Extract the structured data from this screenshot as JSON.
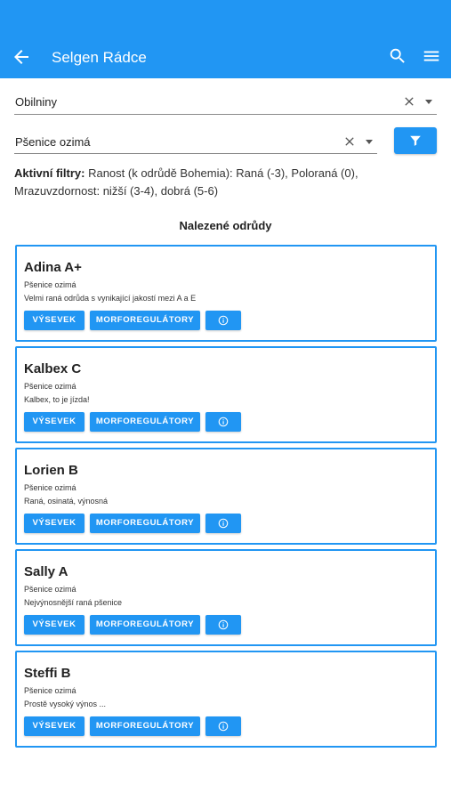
{
  "app": {
    "title": "Selgen Rádce",
    "accent": "#2196f3"
  },
  "selects": {
    "crop": {
      "value": "Obilniny"
    },
    "variety_type": {
      "value": "Pšenice ozimá"
    }
  },
  "filters": {
    "label": "Aktivní filtry:",
    "text": " Ranost (k odrůdě Bohemia): Raná (-3), Poloraná (0), Mrazuvzdornost: nižší (3-4), dobrá (5-6)"
  },
  "results": {
    "title": "Nalezené odrůdy",
    "buttons": {
      "sowing": "VÝSEVEK",
      "growth": "MORFOREGULÁTORY"
    },
    "items": [
      {
        "name": "Adina A+",
        "crop": "Pšenice ozimá",
        "desc": "Velmi raná odrůda s vynikající jakostí mezi A a E"
      },
      {
        "name": "Kalbex C",
        "crop": "Pšenice ozimá",
        "desc": "Kalbex, to je jízda!"
      },
      {
        "name": "Lorien B",
        "crop": "Pšenice ozimá",
        "desc": "Raná, osinatá, výnosná"
      },
      {
        "name": "Sally A",
        "crop": "Pšenice ozimá",
        "desc": "Nejvýnosnější raná pšenice"
      },
      {
        "name": "Steffi B",
        "crop": "Pšenice ozimá",
        "desc": "Prostě vysoký výnos ..."
      }
    ]
  },
  "icons": [
    "back-arrow-icon",
    "search-icon",
    "menu-icon",
    "clear-icon",
    "dropdown-arrow-icon",
    "filter-icon",
    "info-icon"
  ]
}
